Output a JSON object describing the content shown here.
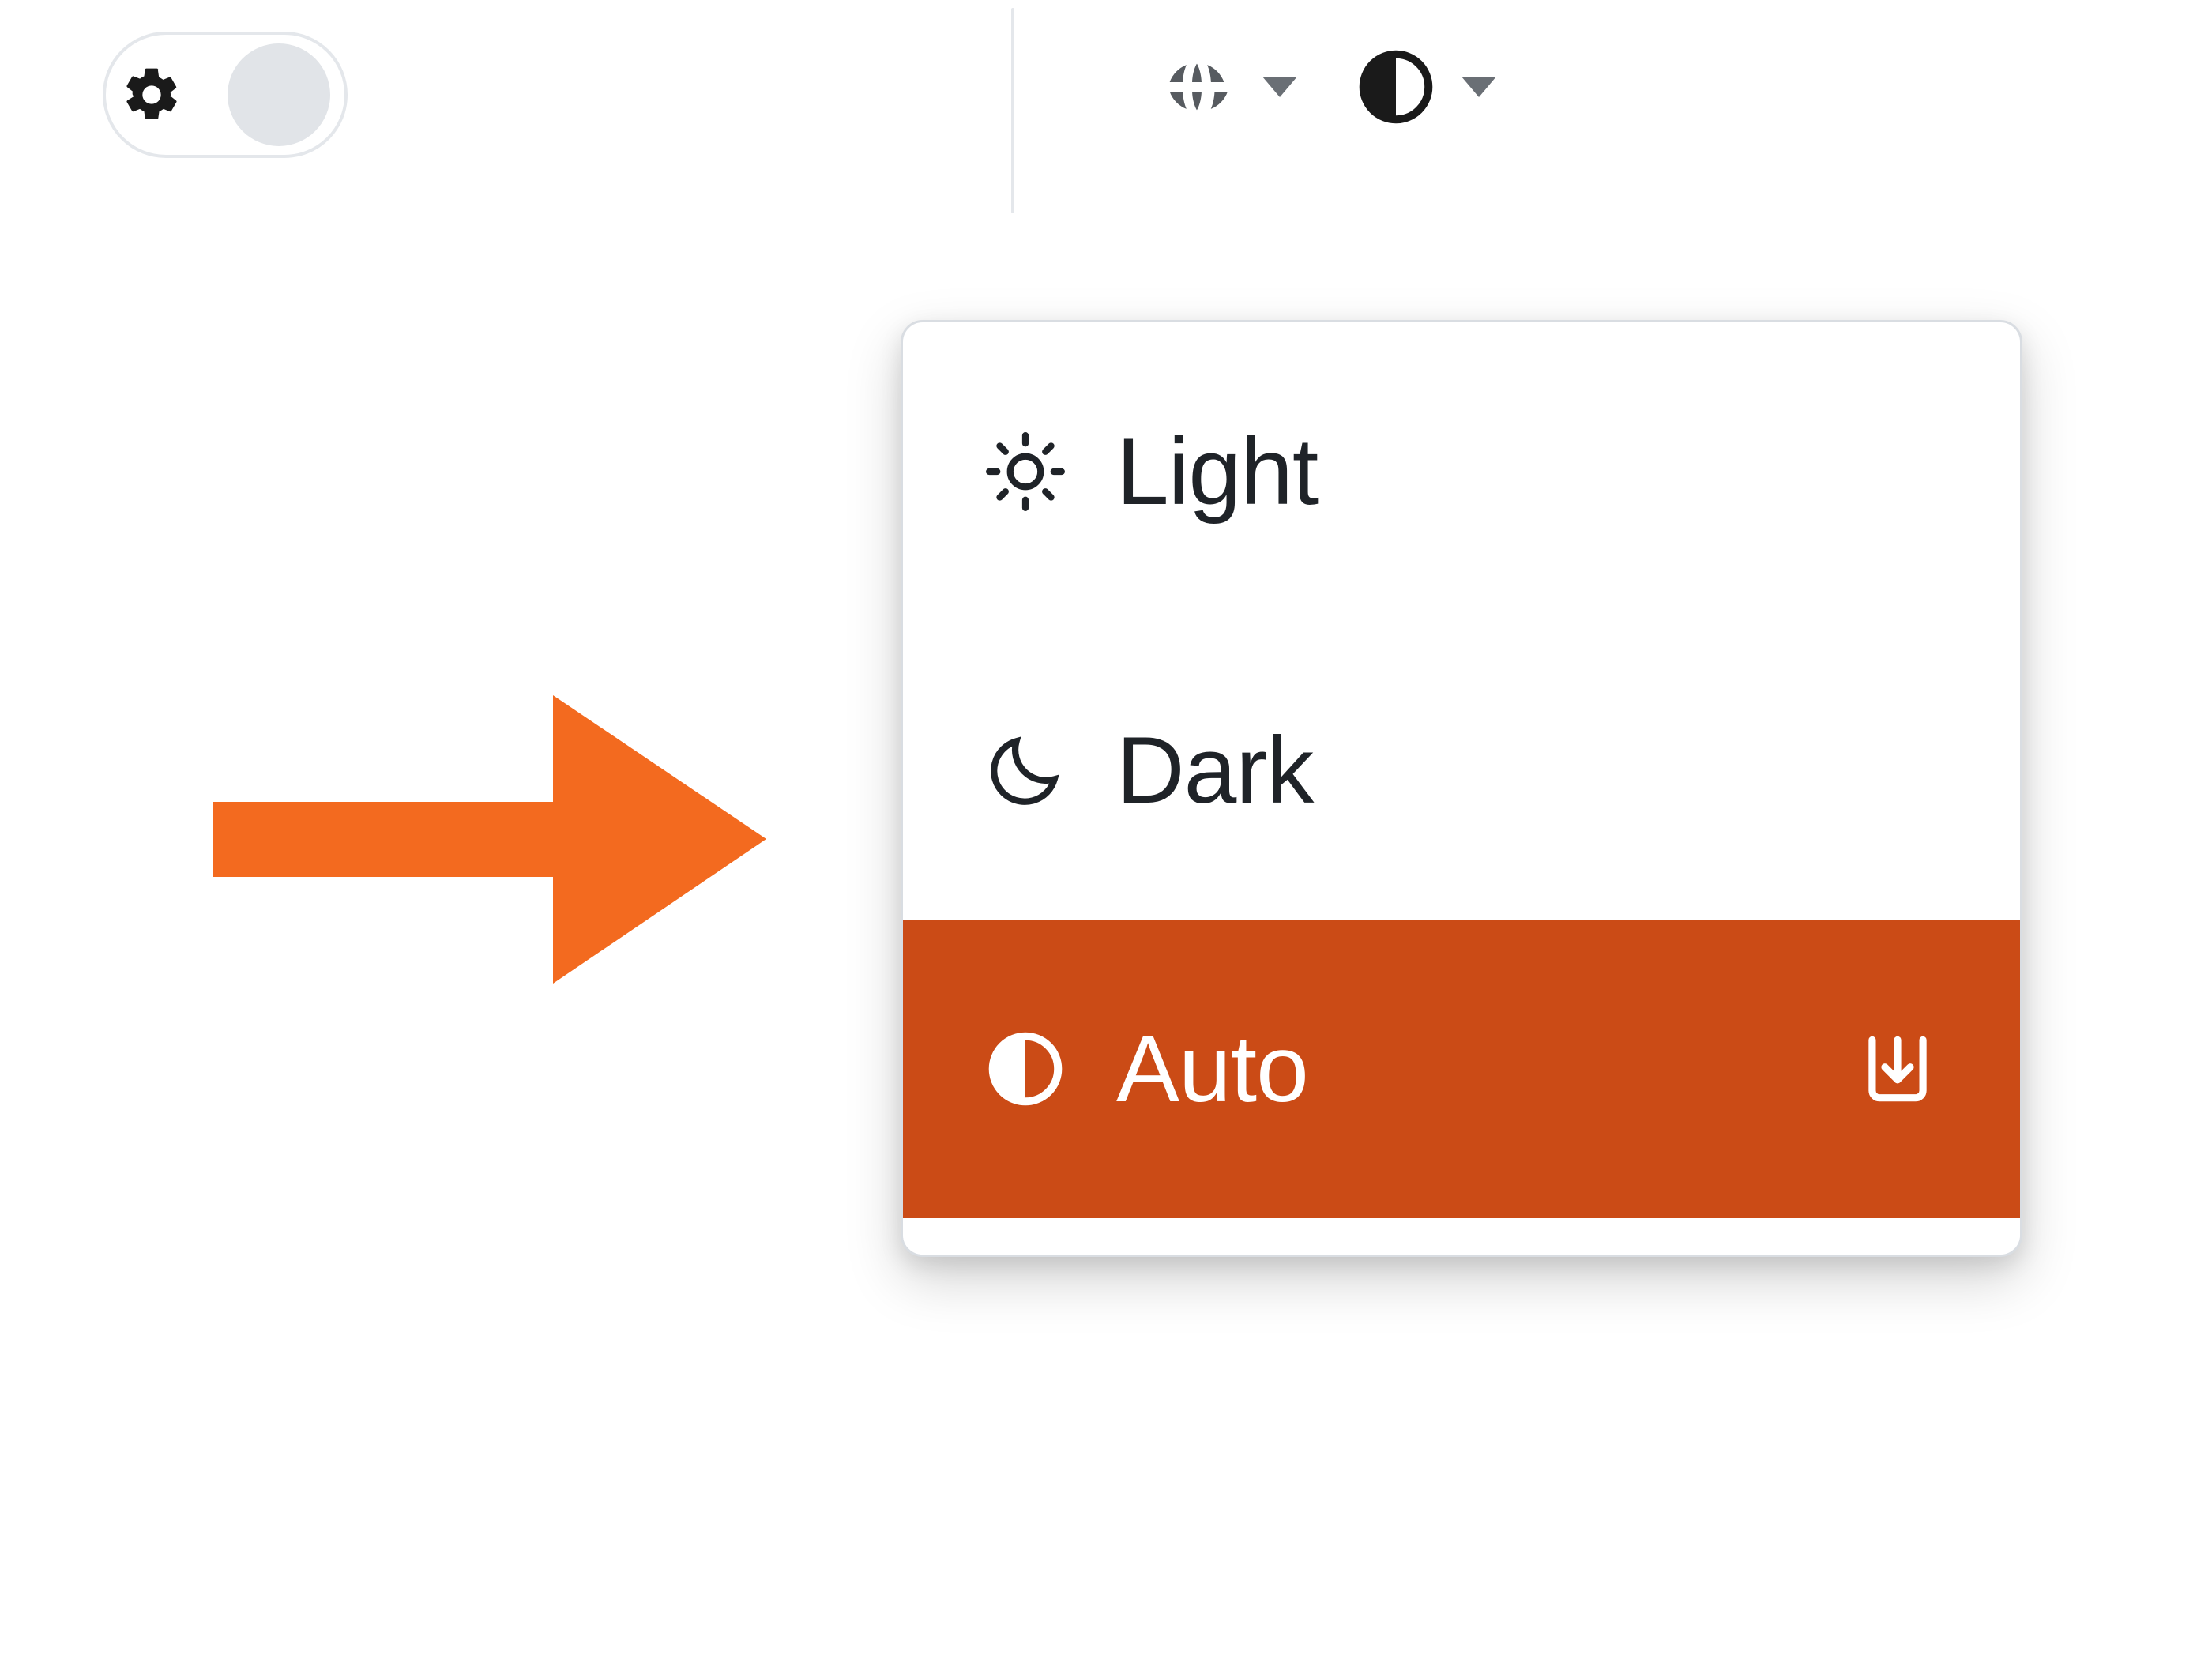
{
  "colors": {
    "accent": "#cb4b16",
    "arrow": "#f36a1f"
  },
  "settings_toggle": {
    "icon": "gear-icon",
    "state": "off"
  },
  "toolbar": {
    "language_dropdown": {
      "icon": "globe-icon"
    },
    "theme_dropdown": {
      "icon": "contrast-icon"
    }
  },
  "theme_menu": {
    "items": [
      {
        "icon": "sun-icon",
        "label": "Light",
        "selected": false
      },
      {
        "icon": "moon-icon",
        "label": "Dark",
        "selected": false
      },
      {
        "icon": "contrast-icon",
        "label": "Auto",
        "selected": true,
        "trailing_icon": "download-icon"
      }
    ]
  },
  "annotation": {
    "arrow_direction": "right"
  }
}
